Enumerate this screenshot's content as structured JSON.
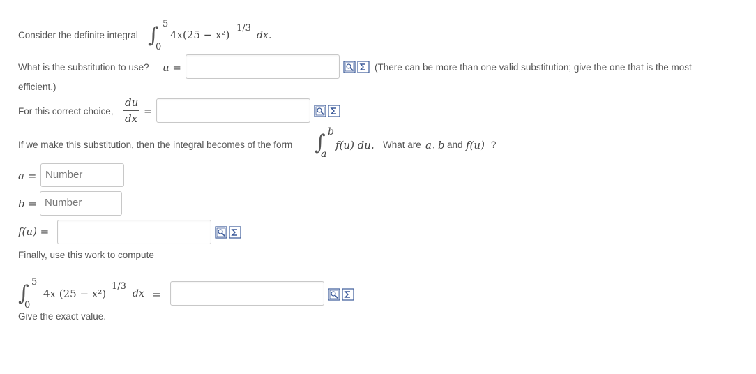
{
  "q1": {
    "prefix": "Consider the definite integral",
    "upper": "5",
    "lower": "0",
    "integrand": "4x(25 − x²)",
    "exponent": "1/3",
    "dx": "dx."
  },
  "q2": {
    "prompt": "What is the substitution to use?",
    "var": "u =",
    "note_line1": "(There can be more than one valid substitution; give the one that is the most",
    "note_line2": "efficient.)"
  },
  "q3": {
    "prompt": "For this correct choice,",
    "num": "du",
    "den": "dx",
    "eq": "="
  },
  "q4": {
    "prompt": "If we make this substitution, then the integral becomes of the form",
    "upper": "b",
    "lower": "a",
    "integrand": "f(u) du.",
    "question_pre": "What are",
    "a": "a",
    "comma": ",",
    "b": "b",
    "and": "and",
    "fu": "f(u)",
    "qmark": "?"
  },
  "fields": {
    "a_label": "a =",
    "a_placeholder": "Number",
    "b_label": "b =",
    "b_placeholder": "Number",
    "f_label": "f(u) ="
  },
  "final": {
    "prompt": "Finally, use this work to compute",
    "upper": "5",
    "lower": "0",
    "integrand": "4x (25 − x²)",
    "exponent": "1/3",
    "dx": "dx",
    "eq": "=",
    "hint": "Give the exact value."
  },
  "icons": {
    "preview": "preview-icon",
    "equation_editor": "equation-editor-icon"
  },
  "colors": {
    "text": "#555555",
    "input_border": "#c8c8c8",
    "icon_blue": "#3b5a9a"
  }
}
